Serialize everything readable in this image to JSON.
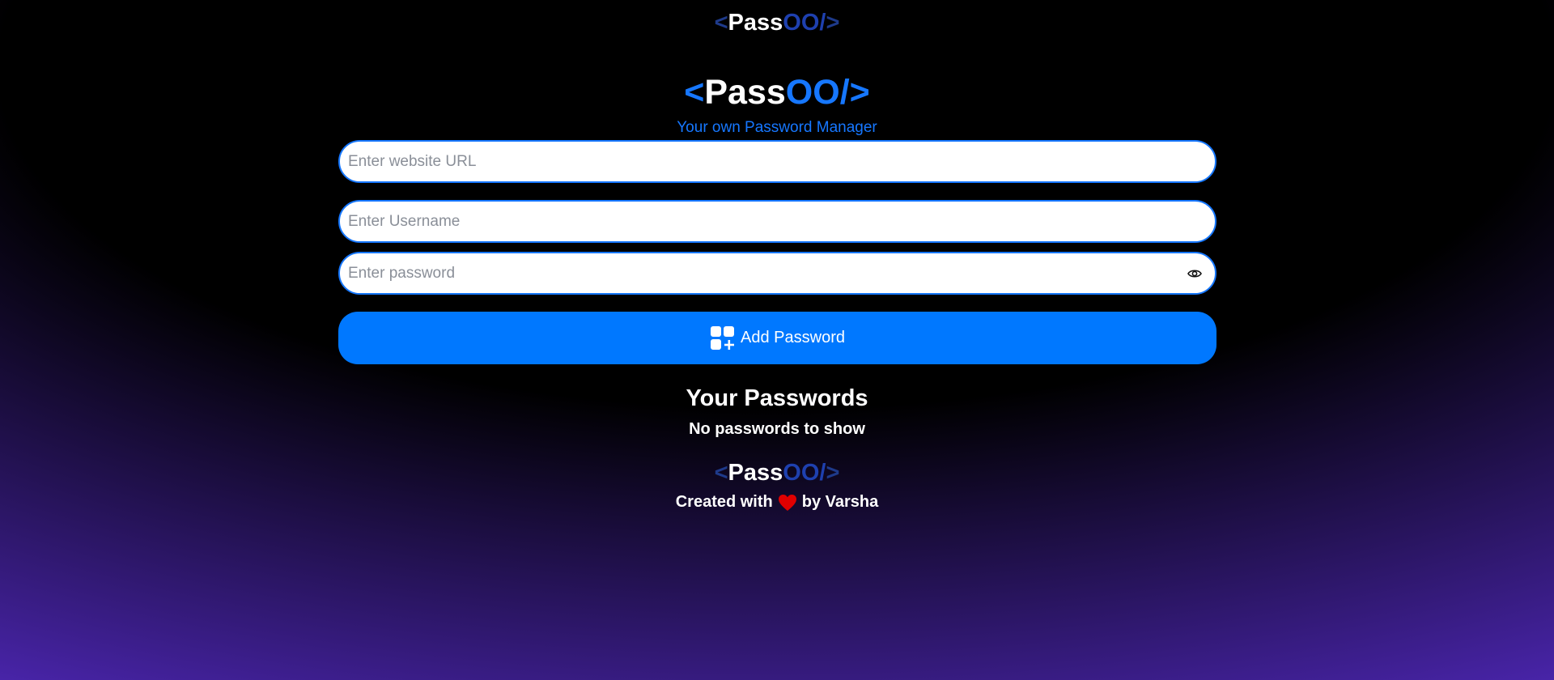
{
  "navbar": {
    "logo": {
      "open": "<",
      "pass": "Pass",
      "oo": "OO/",
      "close": ">"
    }
  },
  "hero": {
    "logo": {
      "open": "<",
      "pass": "Pass",
      "oo": "OO/",
      "close": ">"
    },
    "tagline": "Your own Password Manager"
  },
  "form": {
    "url_placeholder": "Enter website URL",
    "url_value": "",
    "username_placeholder": "Enter Username",
    "username_value": "",
    "password_placeholder": "Enter password",
    "password_value": "",
    "add_button_label": "Add Password"
  },
  "passwords": {
    "heading": "Your Passwords",
    "empty_message": "No passwords to show"
  },
  "footer": {
    "logo": {
      "open": "<",
      "pass": "Pass",
      "oo": "OO/",
      "close": ">"
    },
    "credit_prefix": "Created with",
    "credit_suffix": "by Varsha"
  },
  "icons": {
    "eye": "eye-icon",
    "add": "add-grid-icon",
    "heart": "heart-icon"
  },
  "colors": {
    "accent": "#1677ff",
    "button": "#0078ff",
    "heart": "#e00000",
    "background_glow": "#6633ee"
  }
}
